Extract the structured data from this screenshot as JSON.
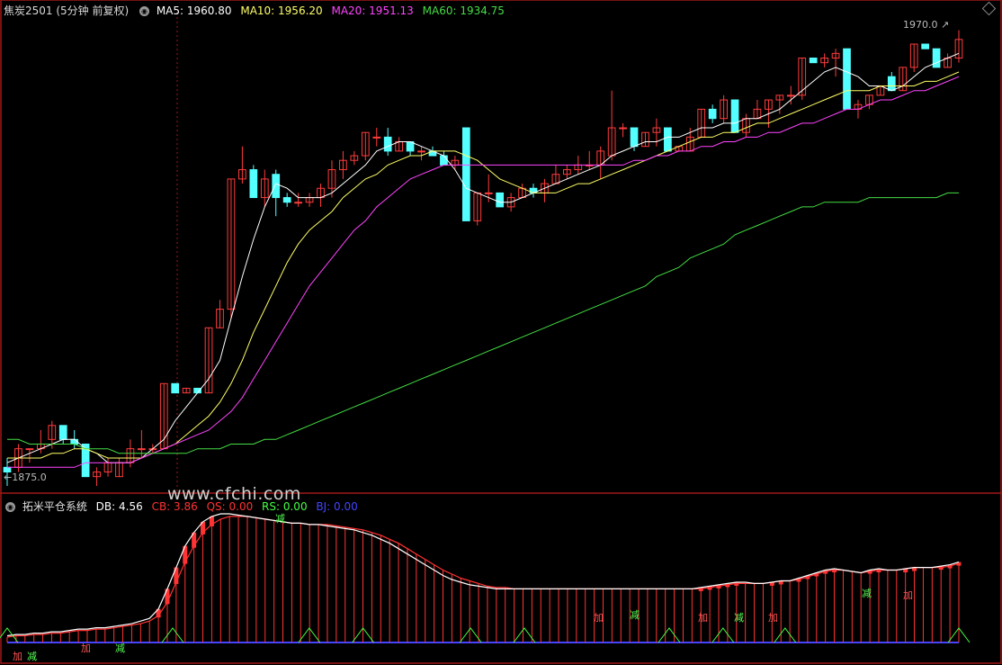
{
  "header": {
    "symbol_period": "焦炭2501 (5分钟 前复权)",
    "ma5": "MA5: 1960.80",
    "ma10": "MA10: 1956.20",
    "ma20": "MA20: 1951.13",
    "ma60": "MA60: 1934.75"
  },
  "indicator_header": {
    "name": "拓米平仓系统",
    "db": "DB: 4.56",
    "cb": "CB: 3.86",
    "qs": "QS: 0.00",
    "rs": "RS: 0.00",
    "bj": "BJ: 0.00"
  },
  "price_labels": {
    "high": "1970.0",
    "low": "1875.0"
  },
  "watermark": "www.cfchi.com",
  "signal_labels": {
    "add": "加",
    "reduce": "减"
  },
  "colors": {
    "background": "#000000",
    "frame": "#a01818",
    "up": "#ff3c3c",
    "down": "#54ffff",
    "ma5": "#ffffff",
    "ma10": "#ffff66",
    "ma20": "#ff44ff",
    "ma60": "#44dd44",
    "db": "#ffffff",
    "cb": "#ff3333",
    "qs": "#ff3333",
    "rs": "#44ff44",
    "bj": "#4444ff"
  },
  "chart_data": [
    {
      "type": "candlestick",
      "title": "焦炭2501 (5分钟 前复权)",
      "ylim": [
        1872,
        1973
      ],
      "labels": {
        "max": 1970.0,
        "min": 1875.0
      },
      "ohlc": [
        [
          1876,
          1878,
          1872,
          1875
        ],
        [
          1876,
          1881,
          1875,
          1880
        ],
        [
          1880,
          1880,
          1877,
          1880
        ],
        [
          1880,
          1884,
          1879,
          1881
        ],
        [
          1882,
          1886,
          1880,
          1885
        ],
        [
          1885,
          1885,
          1881,
          1882
        ],
        [
          1882,
          1884,
          1880,
          1881
        ],
        [
          1881,
          1881,
          1874,
          1874
        ],
        [
          1874,
          1876,
          1872,
          1875
        ],
        [
          1875,
          1878,
          1874,
          1877
        ],
        [
          1874,
          1878,
          1874,
          1877
        ],
        [
          1877,
          1882,
          1876,
          1880
        ],
        [
          1880,
          1884,
          1878,
          1880
        ],
        [
          1880,
          1881,
          1879,
          1880
        ],
        [
          1880,
          1894,
          1880,
          1894
        ],
        [
          1894,
          1894,
          1892,
          1892
        ],
        [
          1892,
          1893,
          1892,
          1893
        ],
        [
          1893,
          1893,
          1892,
          1892
        ],
        [
          1892,
          1906,
          1892,
          1906
        ],
        [
          1906,
          1912,
          1906,
          1910
        ],
        [
          1910,
          1938,
          1908,
          1938
        ],
        [
          1938,
          1945,
          1937,
          1940
        ],
        [
          1940,
          1941,
          1934,
          1934
        ],
        [
          1934,
          1940,
          1932,
          1938
        ],
        [
          1939,
          1940,
          1930,
          1934
        ],
        [
          1934,
          1935,
          1932,
          1933
        ],
        [
          1933,
          1935,
          1932,
          1933
        ],
        [
          1933,
          1935,
          1932,
          1934
        ],
        [
          1934,
          1937,
          1932,
          1936
        ],
        [
          1936,
          1942,
          1934,
          1940
        ],
        [
          1940,
          1944,
          1938,
          1942
        ],
        [
          1942,
          1944,
          1941,
          1943
        ],
        [
          1943,
          1948,
          1942,
          1948
        ],
        [
          1947,
          1949,
          1945,
          1947
        ],
        [
          1947,
          1949,
          1943,
          1944
        ],
        [
          1944,
          1947,
          1944,
          1946
        ],
        [
          1946,
          1946,
          1943,
          1944
        ],
        [
          1944,
          1945,
          1942,
          1944
        ],
        [
          1944,
          1945,
          1943,
          1943
        ],
        [
          1943,
          1944,
          1941,
          1941
        ],
        [
          1941,
          1943,
          1940,
          1942
        ],
        [
          1949,
          1949,
          1929,
          1929
        ],
        [
          1929,
          1935,
          1928,
          1935
        ],
        [
          1935,
          1939,
          1933,
          1935
        ],
        [
          1935,
          1935,
          1932,
          1932
        ],
        [
          1932,
          1935,
          1931,
          1934
        ],
        [
          1934,
          1937,
          1934,
          1936
        ],
        [
          1936,
          1937,
          1934,
          1935
        ],
        [
          1935,
          1938,
          1933,
          1937
        ],
        [
          1937,
          1941,
          1937,
          1939
        ],
        [
          1939,
          1941,
          1938,
          1940
        ],
        [
          1940,
          1943,
          1939,
          1941
        ],
        [
          1941,
          1944,
          1940,
          1941
        ],
        [
          1941,
          1945,
          1938,
          1944
        ],
        [
          1943,
          1957,
          1942,
          1949
        ],
        [
          1949,
          1950,
          1947,
          1949
        ],
        [
          1949,
          1949,
          1944,
          1945
        ],
        [
          1945,
          1948,
          1945,
          1948
        ],
        [
          1948,
          1951,
          1945,
          1949
        ],
        [
          1949,
          1949,
          1944,
          1944
        ],
        [
          1944,
          1945,
          1944,
          1945
        ],
        [
          1944,
          1949,
          1944,
          1947
        ],
        [
          1947,
          1953,
          1947,
          1953
        ],
        [
          1953,
          1954,
          1950,
          1951
        ],
        [
          1951,
          1956,
          1950,
          1955
        ],
        [
          1955,
          1955,
          1948,
          1948
        ],
        [
          1948,
          1952,
          1947,
          1951
        ],
        [
          1951,
          1955,
          1951,
          1953
        ],
        [
          1953,
          1955,
          1949,
          1955
        ],
        [
          1955,
          1956,
          1952,
          1956
        ],
        [
          1956,
          1958,
          1954,
          1956
        ],
        [
          1956,
          1964,
          1955,
          1964
        ],
        [
          1964,
          1964,
          1963,
          1963
        ],
        [
          1963,
          1965,
          1962,
          1964
        ],
        [
          1964,
          1966,
          1960,
          1965
        ],
        [
          1966,
          1966,
          1953,
          1953
        ],
        [
          1953,
          1955,
          1951,
          1954
        ],
        [
          1954,
          1956,
          1953,
          1956
        ],
        [
          1956,
          1958,
          1956,
          1958
        ],
        [
          1960,
          1961,
          1957,
          1957
        ],
        [
          1957,
          1962,
          1957,
          1962
        ],
        [
          1962,
          1967,
          1961,
          1967
        ],
        [
          1967,
          1967,
          1966,
          1966
        ],
        [
          1966,
          1966,
          1962,
          1962
        ],
        [
          1962,
          1965,
          1962,
          1964
        ],
        [
          1964,
          1970,
          1963,
          1968
        ]
      ],
      "series": [
        {
          "name": "MA5",
          "values": [
            1877,
            1878,
            1879,
            1880,
            1881,
            1882,
            1882,
            1880,
            1879,
            1877,
            1877,
            1877,
            1878,
            1880,
            1882,
            1886,
            1889,
            1892,
            1895,
            1899,
            1908,
            1917,
            1925,
            1932,
            1937,
            1936,
            1934,
            1934,
            1934,
            1935,
            1937,
            1939,
            1941,
            1944,
            1945,
            1946,
            1946,
            1945,
            1944,
            1943,
            1940,
            1936,
            1935,
            1934,
            1933,
            1933,
            1934,
            1935,
            1936,
            1937,
            1938,
            1939,
            1940,
            1941,
            1943,
            1944,
            1945,
            1946,
            1946,
            1947,
            1947,
            1948,
            1949,
            1949,
            1950,
            1950,
            1951,
            1951,
            1952,
            1953,
            1955,
            1957,
            1959,
            1961,
            1962,
            1961,
            1960,
            1958,
            1958,
            1957,
            1958,
            1960,
            1962,
            1963,
            1964,
            1965
          ]
        },
        {
          "name": "MA10",
          "values": [
            1878,
            1878,
            1878,
            1878,
            1879,
            1879,
            1880,
            1880,
            1879,
            1878,
            1878,
            1878,
            1878,
            1879,
            1880,
            1881,
            1883,
            1885,
            1887,
            1890,
            1894,
            1899,
            1905,
            1910,
            1915,
            1920,
            1924,
            1927,
            1929,
            1931,
            1934,
            1936,
            1938,
            1939,
            1941,
            1942,
            1943,
            1943,
            1944,
            1944,
            1944,
            1943,
            1942,
            1940,
            1938,
            1937,
            1936,
            1935,
            1935,
            1935,
            1936,
            1937,
            1937,
            1938,
            1939,
            1940,
            1941,
            1942,
            1943,
            1944,
            1945,
            1946,
            1947,
            1947,
            1948,
            1948,
            1949,
            1950,
            1950,
            1951,
            1952,
            1953,
            1954,
            1955,
            1956,
            1957,
            1957,
            1957,
            1958,
            1958,
            1958,
            1958,
            1959,
            1959,
            1960,
            1961
          ]
        },
        {
          "name": "MA20",
          "values": [
            1876,
            1876,
            1876,
            1876,
            1876,
            1876,
            1876,
            1877,
            1877,
            1877,
            1877,
            1877,
            1878,
            1879,
            1880,
            1881,
            1882,
            1883,
            1884,
            1886,
            1888,
            1891,
            1895,
            1899,
            1903,
            1907,
            1911,
            1915,
            1918,
            1921,
            1924,
            1927,
            1929,
            1932,
            1934,
            1936,
            1938,
            1939,
            1940,
            1941,
            1941,
            1941,
            1941,
            1941,
            1941,
            1941,
            1941,
            1941,
            1941,
            1941,
            1941,
            1941,
            1941,
            1941,
            1941,
            1941,
            1942,
            1942,
            1943,
            1943,
            1944,
            1944,
            1945,
            1945,
            1946,
            1946,
            1947,
            1947,
            1948,
            1948,
            1949,
            1950,
            1950,
            1951,
            1952,
            1953,
            1953,
            1954,
            1955,
            1955,
            1956,
            1957,
            1957,
            1958,
            1959,
            1960
          ]
        },
        {
          "name": "MA60",
          "values": [
            1882,
            1882,
            1881,
            1881,
            1881,
            1881,
            1881,
            1880,
            1880,
            1880,
            1879,
            1879,
            1879,
            1879,
            1879,
            1879,
            1879,
            1880,
            1880,
            1880,
            1881,
            1881,
            1881,
            1882,
            1882,
            1883,
            1884,
            1885,
            1886,
            1887,
            1888,
            1889,
            1890,
            1891,
            1892,
            1893,
            1894,
            1895,
            1896,
            1897,
            1898,
            1899,
            1900,
            1901,
            1902,
            1903,
            1904,
            1905,
            1906,
            1907,
            1908,
            1909,
            1910,
            1911,
            1912,
            1913,
            1914,
            1915,
            1917,
            1918,
            1919,
            1921,
            1922,
            1923,
            1924,
            1926,
            1927,
            1928,
            1929,
            1930,
            1931,
            1932,
            1932,
            1933,
            1933,
            1933,
            1933,
            1934,
            1934,
            1934,
            1934,
            1934,
            1934,
            1934,
            1935,
            1935
          ]
        }
      ]
    },
    {
      "type": "bar",
      "title": "拓米平仓系统",
      "ylim": [
        0,
        100
      ],
      "series": [
        {
          "name": "DB",
          "values": [
            5,
            6,
            6,
            7,
            7,
            8,
            8,
            9,
            10,
            10,
            11,
            11,
            12,
            13,
            14,
            16,
            18,
            25,
            40,
            56,
            72,
            82,
            90,
            94,
            96,
            96,
            95,
            94,
            93,
            92,
            91,
            90,
            89,
            89,
            88,
            88,
            87,
            86,
            85,
            84,
            82,
            80,
            77,
            74,
            70,
            66,
            62,
            58,
            54,
            50,
            47,
            45,
            43,
            42,
            41,
            40,
            40,
            40,
            40,
            40,
            40,
            40,
            40,
            40,
            40,
            40,
            40,
            40,
            40,
            40,
            40,
            40,
            40,
            40,
            40,
            40,
            40,
            40,
            41,
            42,
            43,
            44,
            45,
            45,
            44,
            44,
            45,
            46,
            46,
            48,
            50,
            52,
            54,
            55,
            54,
            53,
            52,
            54,
            55,
            54,
            54,
            55,
            56,
            56,
            56,
            57,
            58,
            60
          ]
        },
        {
          "name": "CB",
          "values": [
            4,
            5,
            5,
            6,
            6,
            7,
            7,
            8,
            9,
            9,
            10,
            10,
            11,
            12,
            13,
            14,
            16,
            20,
            30,
            45,
            60,
            72,
            82,
            88,
            92,
            94,
            94,
            94,
            93,
            92,
            91,
            90,
            89,
            89,
            88,
            88,
            88,
            87,
            86,
            85,
            84,
            82,
            80,
            77,
            74,
            70,
            66,
            62,
            58,
            54,
            51,
            48,
            46,
            44,
            42,
            41,
            41,
            40,
            40,
            40,
            40,
            40,
            40,
            40,
            40,
            40,
            40,
            40,
            40,
            40,
            40,
            40,
            40,
            40,
            40,
            40,
            40,
            40,
            40,
            41,
            42,
            43,
            44,
            44,
            44,
            44,
            45,
            46,
            46,
            47,
            49,
            51,
            53,
            54,
            54,
            53,
            52,
            53,
            54,
            54,
            54,
            55,
            56,
            56,
            56,
            56,
            57,
            59
          ]
        }
      ]
    }
  ]
}
